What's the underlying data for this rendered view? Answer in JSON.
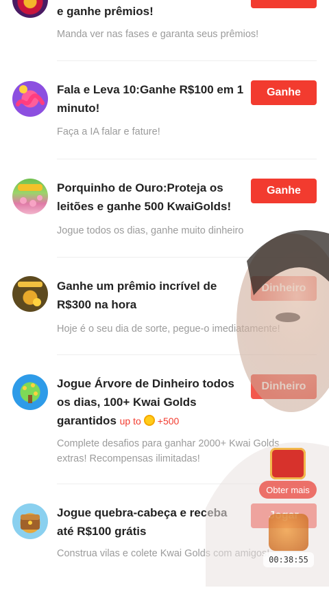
{
  "tasks": [
    {
      "title": "e ganhe prêmios!",
      "desc": "Manda ver nas fases e garanta seus prêmios!",
      "button": ""
    },
    {
      "title": "Fala e Leva 10:Ganhe R$100 em 1 minuto!",
      "desc": "Faça a IA falar e fature!",
      "button": "Ganhe"
    },
    {
      "title": "Porquinho de Ouro:Proteja os leitões e ganhe 500 KwaiGolds!",
      "desc": "Jogue todos os dias, ganhe muito dinheiro",
      "button": "Ganhe"
    },
    {
      "title": "Ganhe um prêmio incrível de R$300 na hora",
      "desc": "Hoje é o seu dia de sorte, pegue-o imediatamente!",
      "button": "Dinheiro"
    },
    {
      "title": "Jogue Árvore de Dinheiro todos os dias, 100+ Kwai Golds garantidos",
      "bonus_prefix": "up to",
      "bonus_value": "+500",
      "desc": "Complete desafios para ganhar 2000+ Kwai Golds extras! Recompensas ilimitadas!",
      "button": "Dinheiro"
    },
    {
      "title": "Jogue quebra-cabeça e receba até R$100 grátis",
      "desc": "Construa vilas e colete Kwai Golds com amigos!",
      "button": "Jogar"
    }
  ],
  "floating": {
    "label": "Obter mais",
    "timer": "00:38:55"
  },
  "colors": {
    "accent": "#f23b2f",
    "title": "#222222",
    "desc": "#9b9b9b"
  }
}
